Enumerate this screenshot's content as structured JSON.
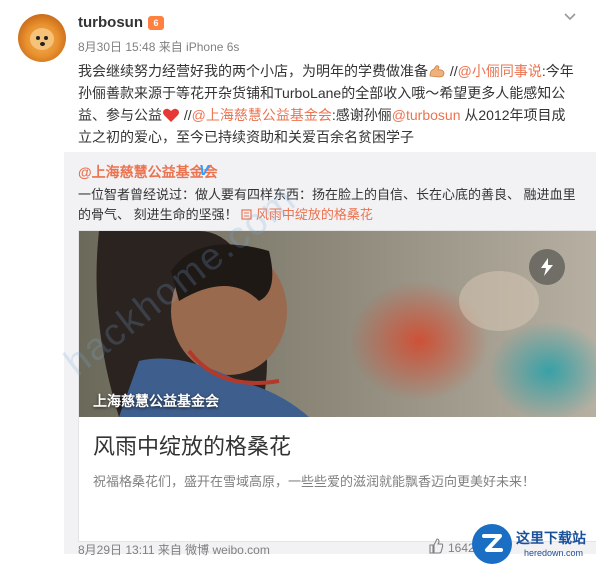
{
  "post": {
    "username": "turbosun",
    "vip_badge": "6",
    "meta": "8月30日 15:48 来自 iPhone 6s",
    "content": {
      "line1_a": "我会继续努力经营好我的两个小店，为明年的学费做准备",
      "line1_b": " //",
      "mention1": "@小俪同事说",
      "line1_c": ":今年孙俪善款来源于等花开杂货铺和TurboLane的全部收入哦～希望更多人能感知公益、参与公益",
      "line2_a": " //",
      "mention2": "@上海慈慧公益基金会",
      "line2_b": ":感谢孙俪",
      "mention3": "@turbosun",
      "line2_c": " 从2012年项目成立之初的爱心，至今已持续资助和关爱百余名贫困学子"
    }
  },
  "share": {
    "author_at": "@上海慈慧公益基金会",
    "verified_badge": "V",
    "text": "一位智者曾经说过：做人要有四样东西：扬在脸上的自信、长在心底的善良、 融进血里的骨气、 刻进生命的坚强！",
    "link_text": "风雨中绽放的格桑花",
    "card": {
      "image_caption": "上海慈慧公益基金会",
      "title": "风雨中绽放的格桑花",
      "description": "祝福格桑花们，盛开在雪域高原，一些些爱的滋润就能飘香迈向更美好未来！"
    },
    "footer": "8月29日 13:11 来自 微博 weibo.com",
    "like_count": "1642"
  },
  "watermark": {
    "title": "这里下载站",
    "url": "heredown.com",
    "diagonal": "hackhome.com"
  },
  "colors": {
    "link": "#eb7350",
    "verified": "#2e9fff",
    "muted": "#808080",
    "share_bg": "#f2f2f5"
  },
  "icons": [
    "chevron-down-icon",
    "flex-arm-emoji-icon",
    "heart-emoji-icon",
    "lightning-play-icon",
    "like-thumb-icon",
    "link-icon"
  ]
}
